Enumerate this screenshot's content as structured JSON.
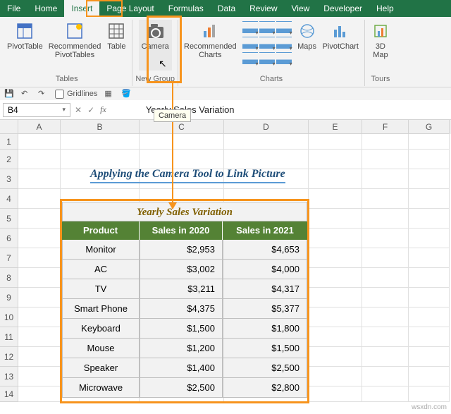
{
  "menu": {
    "file": "File",
    "home": "Home",
    "insert": "Insert",
    "page_layout": "Page Layout",
    "formulas": "Formulas",
    "data": "Data",
    "review": "Review",
    "view": "View",
    "developer": "Developer",
    "help": "Help"
  },
  "ribbon": {
    "pivot_table": "PivotTable",
    "rec_pivot": "Recommended\nPivotTables",
    "table": "Table",
    "camera": "Camera",
    "rec_charts": "Recommended\nCharts",
    "maps": "Maps",
    "pivot_chart": "PivotChart",
    "map3d": "3D\nMap",
    "group_tables": "Tables",
    "group_new": "New Group",
    "group_charts": "Charts",
    "group_tours": "Tours"
  },
  "qat": {
    "gridlines": "Gridlines"
  },
  "name_box": "B4",
  "formula": "Yearly Sales Variation",
  "tooltip": "Camera",
  "content": {
    "page_title": "Applying the Camera Tool to Link Picture",
    "table_title": "Yearly Sales Variation",
    "head": {
      "product": "Product",
      "s20": "Sales in 2020",
      "s21": "Sales in 2021"
    },
    "rows": [
      {
        "p": "Monitor",
        "a": "$2,953",
        "b": "$4,653"
      },
      {
        "p": "AC",
        "a": "$3,002",
        "b": "$4,000"
      },
      {
        "p": "TV",
        "a": "$3,211",
        "b": "$4,317"
      },
      {
        "p": "Smart Phone",
        "a": "$4,375",
        "b": "$5,377"
      },
      {
        "p": "Keyboard",
        "a": "$1,500",
        "b": "$1,800"
      },
      {
        "p": "Mouse",
        "a": "$1,200",
        "b": "$1,500"
      },
      {
        "p": "Speaker",
        "a": "$1,400",
        "b": "$2,500"
      },
      {
        "p": "Microwave",
        "a": "$2,500",
        "b": "$2,800"
      }
    ]
  },
  "cols": {
    "A": "A",
    "B": "B",
    "C": "C",
    "D": "D",
    "E": "E",
    "F": "F",
    "G": "G"
  },
  "watermark": "wsxdn.com"
}
